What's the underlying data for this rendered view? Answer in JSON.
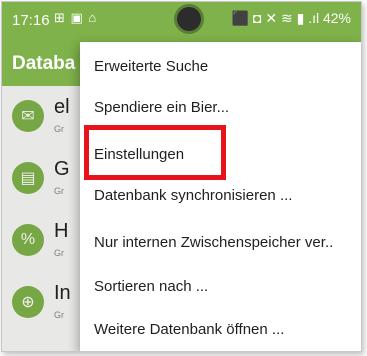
{
  "statusbar": {
    "time": "17:16",
    "left_icons": "⊞ ▣ ⌂",
    "right_text": "⬛ ◘ ✕ ≋ ▮ .ıl 42%"
  },
  "toolbar": {
    "title": "Databa"
  },
  "entries": [
    {
      "title": "el",
      "sub": "Gr",
      "icon": "✉"
    },
    {
      "title": "G",
      "sub": "Gr",
      "icon": "▤"
    },
    {
      "title": "H",
      "sub": "Gr",
      "icon": "%"
    },
    {
      "title": "In",
      "sub": "Gr",
      "icon": "⊕"
    }
  ],
  "menu": {
    "items": [
      "Erweiterte Suche",
      "Spendiere ein Bier...",
      "Einstellungen",
      "Datenbank synchronisieren ...",
      "Nur internen Zwischenspeicher ver..",
      "Sortieren nach ...",
      "Weitere Datenbank öffnen ..."
    ]
  },
  "colors": {
    "accent": "#7fb24a",
    "highlight": "#e8131a"
  }
}
